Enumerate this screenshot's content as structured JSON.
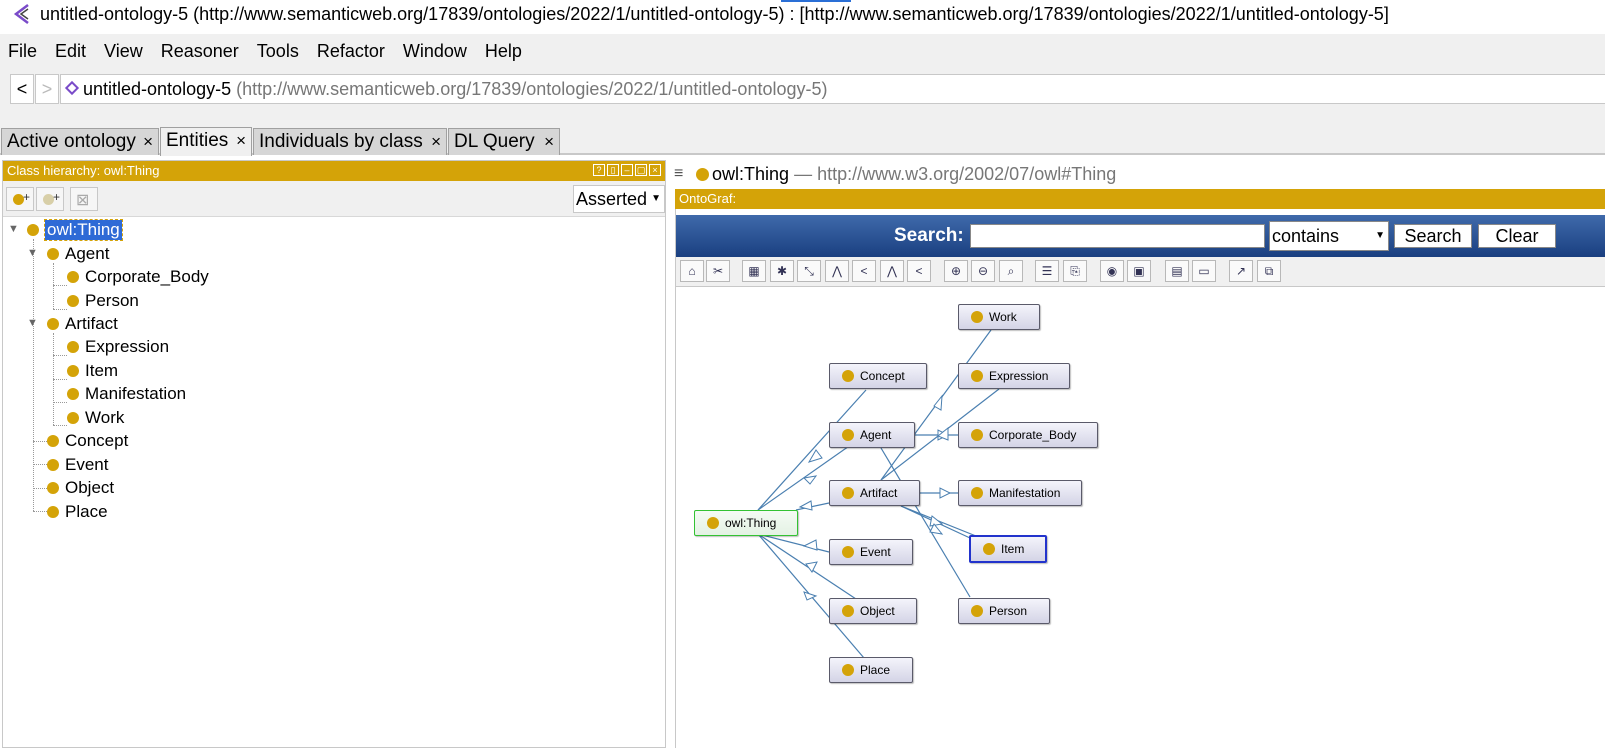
{
  "window": {
    "title": "untitled-ontology-5 (http://www.semanticweb.org/17839/ontologies/2022/1/untitled-ontology-5)  : [http://www.semanticweb.org/17839/ontologies/2022/1/untitled-ontology-5]"
  },
  "menu": [
    "File",
    "Edit",
    "View",
    "Reasoner",
    "Tools",
    "Refactor",
    "Window",
    "Help"
  ],
  "nav": {
    "back": "<",
    "forward": ">",
    "ontology_name": "untitled-ontology-5",
    "ontology_iri": "(http://www.semanticweb.org/17839/ontologies/2022/1/untitled-ontology-5)"
  },
  "tabs": [
    {
      "label": "Active ontology",
      "active": false
    },
    {
      "label": "Entities",
      "active": true
    },
    {
      "label": "Individuals by class",
      "active": false
    },
    {
      "label": "DL Query",
      "active": false
    }
  ],
  "tab_close": "×",
  "class_hierarchy": {
    "header": "Class hierarchy: owl:Thing",
    "mode": "Asserted",
    "tree": {
      "root": "owl:Thing",
      "agent": "Agent",
      "corporate_body": "Corporate_Body",
      "person": "Person",
      "artifact": "Artifact",
      "expression": "Expression",
      "item": "Item",
      "manifestation": "Manifestation",
      "work": "Work",
      "concept": "Concept",
      "event": "Event",
      "object": "Object",
      "place": "Place"
    }
  },
  "entity_header": {
    "name": "owl:Thing",
    "iri": "— http://www.w3.org/2002/07/owl#Thing"
  },
  "ontograf": {
    "header": "OntoGraf:",
    "search_label": "Search:",
    "search_value": "",
    "match_mode": "contains",
    "search_button": "Search",
    "clear_button": "Clear",
    "nodes": {
      "work": "Work",
      "concept": "Concept",
      "expression": "Expression",
      "agent": "Agent",
      "corporate_body": "Corporate_Body",
      "artifact": "Artifact",
      "manifestation": "Manifestation",
      "owl_thing": "owl:Thing",
      "item": "Item",
      "event": "Event",
      "object": "Object",
      "person": "Person",
      "place": "Place"
    }
  },
  "colors": {
    "class_bullet": "#d4a308",
    "header_bar": "#d4a308",
    "selection": "#2e6ad6",
    "edge": "#4a7fb0",
    "root_border": "#33c233",
    "highlight_border": "#2233cc"
  }
}
